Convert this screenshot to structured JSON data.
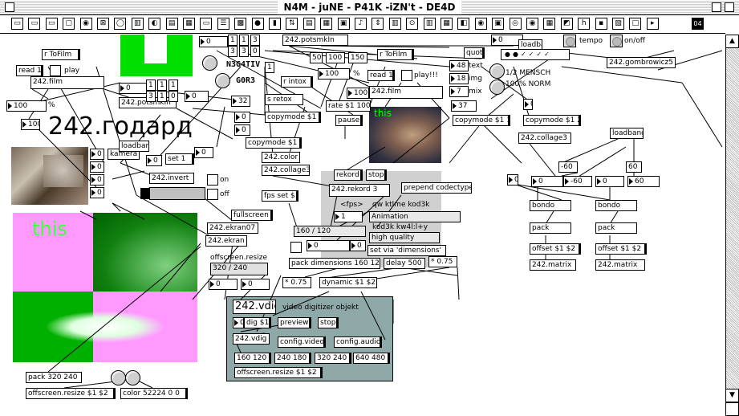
{
  "window": {
    "title": "N4M - juNE - P41K -iZN't - DE4D"
  },
  "toolbar": {
    "icons": [
      "new-object",
      "new-comment",
      "new-message",
      "new-number",
      "new-flonum",
      "new-toggle",
      "new-button",
      "new-slider",
      "new-dial",
      "new-kslider",
      "new-panel",
      "new-lcd",
      "new-ubumenu",
      "new-bpatcher",
      "new-led",
      "new-meter",
      "new-gswitch",
      "new-umenu",
      "new-matrixctrl",
      "new-pictctl",
      "new-keyboard",
      "new-incdec",
      "new-rslider",
      "new-radiogroup",
      "new-multislider",
      "new-table",
      "new-lcd2",
      "new-led2",
      "new-panel2",
      "new-record",
      "new-stop",
      "new-nodes",
      "new-fpic",
      "new-hint",
      "new-pict",
      "new-grid",
      "new-print",
      "new-more"
    ],
    "last_label": "04"
  },
  "colors": {
    "green": "#00e000",
    "pink": "#ff99ff",
    "gray_panel": "#8fa8a8",
    "light_gray": "#d0d0d0"
  },
  "text": {
    "big_title": "242.годард",
    "this_1": "this",
    "this_2": "this",
    "header_1": "N3G4TIV",
    "header_2": "G0R3",
    "vdig_title": "242.vdig",
    "vdig_comment": "video digitizer objekt",
    "o1": "r ToFilm",
    "o2": "read 1",
    "o3": "play",
    "o4": "242.film",
    "o5": "100",
    "o6": "%",
    "o7": "100",
    "o8": "0",
    "o9": "242.potsmkIn",
    "o10": "242.potsmkIn",
    "o11": "0",
    "o12": "1",
    "o13": "1",
    "o14": "3",
    "o15": "0",
    "o16": "r intox",
    "o17": "s retox",
    "o18": "32",
    "o19": "0",
    "o20": "copymode $1 1",
    "o21": "copymode $1 2",
    "o22": "0",
    "o23": "0",
    "o24": "242.color",
    "o25": "242.collage3",
    "o26": "set 1",
    "o27": "242.invert",
    "o28": "on",
    "o29": "off",
    "o30": "kamera",
    "o31": "loadbang",
    "o32": "fullscreen",
    "o33": "242.ekran07",
    "o34": "242.ekran",
    "o35": "offscreen.resize",
    "o36": "320 / 240",
    "o37": "0",
    "o38": "0",
    "o39": "fps set $1",
    "o40": "50",
    "o41": "100",
    "o42": "150",
    "o43": "100",
    "o44": "%",
    "o45": "r ToFilm",
    "o46": "read 1",
    "o47": "play!!!",
    "o48": "100",
    "o49": "242.film",
    "o50": "rate $1 100",
    "o51": "pause",
    "o52": "rekord",
    "o53": "stop",
    "o54": "242.rekord 3",
    "o55": "prepend codectype",
    "o56": "<fps>",
    "o57": "qw ktlme kod3k",
    "o58": "1",
    "o59": "Animation",
    "o60": "kod3k kw4l:l+y",
    "o61": "high quality",
    "o62": "160 / 120",
    "o63": "0",
    "o64": "0",
    "o65": "set via 'dimensions'",
    "o66": "pack dimensions 160 120",
    "o67": "delay 500",
    "o68": "* 0.75",
    "o69": "* 0.75",
    "o70": "dynamic $1 $2",
    "o71": "quote",
    "o72": "48",
    "o73": "text",
    "o74": "18",
    "o75": "img",
    "o76": "7",
    "o77": "mix",
    "o78": "37",
    "o79": "copymode $1 1",
    "o80": "copymode $1 2",
    "o81": "242.collage3",
    "o82": "0",
    "o83": "loadbang",
    "o84": "1/2 MENSCH",
    "o85": "100% NORM",
    "o86": "0",
    "o87": "tempo",
    "o88": "on/off",
    "o89": "242.gombrowicz5",
    "o90": "loadbang",
    "o91": "60",
    "o92": "-60",
    "o93": "0",
    "o94": "-60",
    "o95": "0",
    "o96": "60",
    "o97": "0",
    "o98": "bondo",
    "o99": "pack",
    "o100": "offset $1 $2",
    "o101": "242.matrix",
    "o102": "bondo",
    "o103": "pack",
    "o104": "offset $1 $2",
    "o105": "242.matrix",
    "o106": "dig $1",
    "o107": "preview",
    "o108": "stop",
    "o109": "242.vdig",
    "o110": "config.video",
    "o111": "config.audio",
    "o112": "160 120",
    "o113": "240 180",
    "o114": "320 240",
    "o115": "640 480",
    "o116": "offscreen.resize $1 $2",
    "o117": "pack 320 240",
    "o118": "offscreen.resize $1 $2",
    "o119": "color 52224 0 0",
    "o120": "0",
    "o121": "3",
    "o122": "1",
    "o123": "0",
    "o124": "1",
    "o125": "1",
    "o126": "1",
    "o127": "1",
    "o128": "3",
    "o129": "3"
  }
}
